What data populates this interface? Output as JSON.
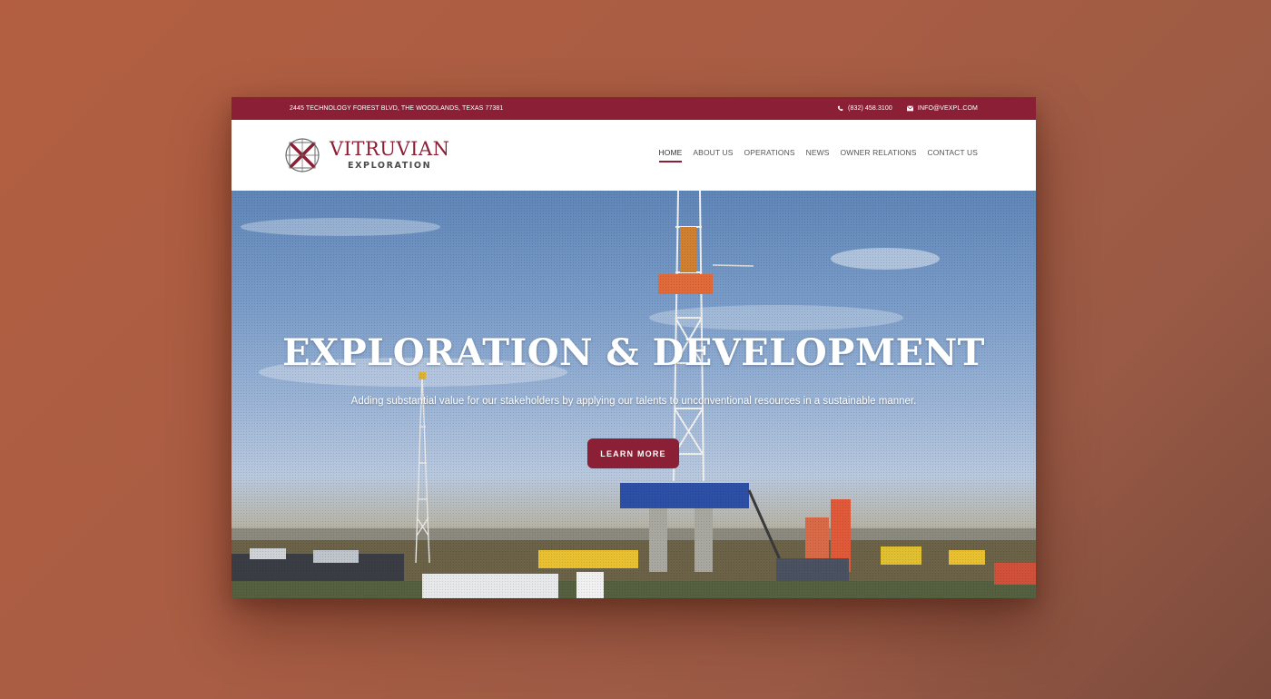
{
  "topbar": {
    "address": "2445 TECHNOLOGY FOREST BLVD, THE WOODLANDS, TEXAS 77381",
    "phone": "(832) 458.3100",
    "email": "INFO@VEXPL.COM"
  },
  "logo": {
    "name": "VITRUVIAN",
    "sub": "EXPLORATION"
  },
  "nav": {
    "items": [
      {
        "label": "HOME",
        "active": true
      },
      {
        "label": "ABOUT US"
      },
      {
        "label": "OPERATIONS"
      },
      {
        "label": "NEWS"
      },
      {
        "label": "OWNER RELATIONS"
      },
      {
        "label": "CONTACT US"
      }
    ]
  },
  "hero": {
    "title": "EXPLORATION & DEVELOPMENT",
    "subtitle": "Adding substantial value for our stakeholders by applying our talents to unconventional resources in a sustainable manner.",
    "button": "LEARN MORE"
  },
  "colors": {
    "brand": "#8b1f36",
    "background": "#b35e40"
  },
  "icons": {
    "phone": "phone-icon",
    "email": "mail-icon",
    "logo": "vitruvian-logo-icon"
  }
}
